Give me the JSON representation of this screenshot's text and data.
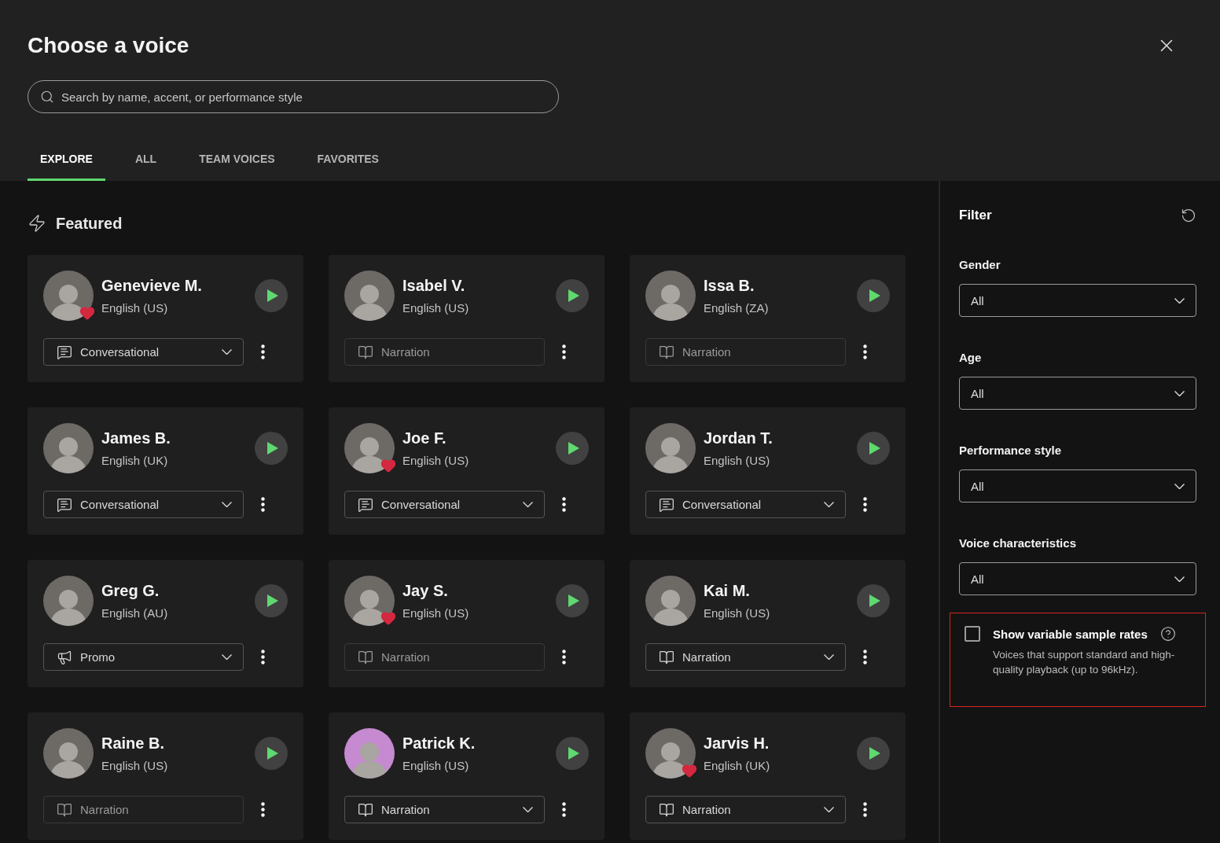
{
  "dialog": {
    "title": "Choose a voice"
  },
  "search": {
    "placeholder": "Search by name, accent, or performance style"
  },
  "tabs": [
    {
      "label": "EXPLORE",
      "selected": true
    },
    {
      "label": "ALL",
      "selected": false
    },
    {
      "label": "TEAM VOICES",
      "selected": false
    },
    {
      "label": "FAVORITES",
      "selected": false
    }
  ],
  "section": {
    "title": "Featured"
  },
  "voices": [
    {
      "name": "Genevieve M.",
      "accent": "English (US)",
      "favorite": true,
      "style": {
        "kind": "conversational",
        "label": "Conversational",
        "disabled": false
      }
    },
    {
      "name": "Isabel V.",
      "accent": "English (US)",
      "favorite": false,
      "style": {
        "kind": "narration",
        "label": "Narration",
        "disabled": true
      }
    },
    {
      "name": "Issa B.",
      "accent": "English (ZA)",
      "favorite": false,
      "style": {
        "kind": "narration",
        "label": "Narration",
        "disabled": true
      }
    },
    {
      "name": "James B.",
      "accent": "English (UK)",
      "favorite": false,
      "style": {
        "kind": "conversational",
        "label": "Conversational",
        "disabled": false
      }
    },
    {
      "name": "Joe F.",
      "accent": "English (US)",
      "favorite": true,
      "style": {
        "kind": "conversational",
        "label": "Conversational",
        "disabled": false
      }
    },
    {
      "name": "Jordan T.",
      "accent": "English (US)",
      "favorite": false,
      "style": {
        "kind": "conversational",
        "label": "Conversational",
        "disabled": false
      }
    },
    {
      "name": "Greg G.",
      "accent": "English (AU)",
      "favorite": false,
      "style": {
        "kind": "promo",
        "label": "Promo",
        "disabled": false
      }
    },
    {
      "name": "Jay S.",
      "accent": "English (US)",
      "favorite": true,
      "style": {
        "kind": "narration",
        "label": "Narration",
        "disabled": true
      }
    },
    {
      "name": "Kai M.",
      "accent": "English (US)",
      "favorite": false,
      "style": {
        "kind": "narration",
        "label": "Narration",
        "disabled": false
      }
    },
    {
      "name": "Raine B.",
      "accent": "English (US)",
      "favorite": false,
      "style": {
        "kind": "narration",
        "label": "Narration",
        "disabled": true
      }
    },
    {
      "name": "Patrick K.",
      "accent": "English (US)",
      "favorite": false,
      "style": {
        "kind": "narration",
        "label": "Narration",
        "disabled": false
      }
    },
    {
      "name": "Jarvis H.",
      "accent": "English (UK)",
      "favorite": true,
      "style": {
        "kind": "narration",
        "label": "Narration",
        "disabled": false
      }
    }
  ],
  "filter": {
    "title": "Filter",
    "fields": [
      {
        "label": "Gender",
        "value": "All"
      },
      {
        "label": "Age",
        "value": "All"
      },
      {
        "label": "Performance style",
        "value": "All"
      },
      {
        "label": "Voice characteristics",
        "value": "All"
      }
    ],
    "sample_rates": {
      "label": "Show variable sample rates",
      "checked": false,
      "description": "Voices that support standard and high-quality playback (up to 96kHz)."
    }
  }
}
